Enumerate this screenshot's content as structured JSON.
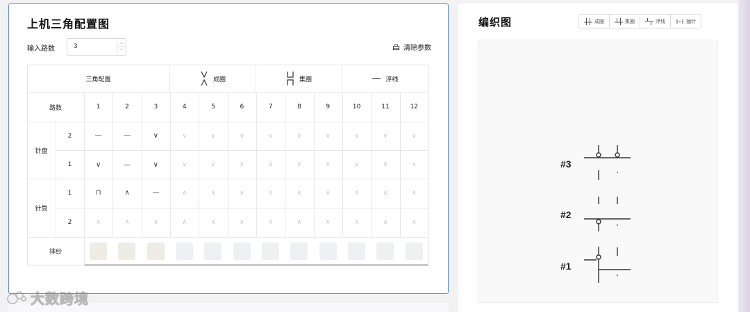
{
  "left_panel": {
    "title": "上机三角配置图",
    "paths_label": "输入路数",
    "paths_value": "3",
    "clear_label": "清除参数"
  },
  "table": {
    "group_headers": [
      {
        "symbol": "",
        "label": "三角配置"
      },
      {
        "symbol": "tuck-icon",
        "label": "成圈"
      },
      {
        "symbol": "knit-icon",
        "label": "集圈"
      },
      {
        "symbol": "float-icon",
        "label": "浮线"
      }
    ],
    "paths_header": "路数",
    "path_numbers": [
      "1",
      "2",
      "3",
      "4",
      "5",
      "6",
      "7",
      "8",
      "9",
      "10",
      "11",
      "12"
    ],
    "dial_label": "针盘",
    "cylinder_label": "针筒",
    "yarn_label": "排纱",
    "rows": [
      {
        "group": "dial",
        "num": "2",
        "symbols": [
          "—",
          "—",
          "∨",
          "∨",
          "∨",
          "∨",
          "∨",
          "∨",
          "∨",
          "∨",
          "∨",
          "∨"
        ]
      },
      {
        "group": "dial",
        "num": "1",
        "symbols": [
          "∨",
          "—",
          "∨",
          "∨",
          "∨",
          "∨",
          "∨",
          "∨",
          "∨",
          "∨",
          "∨",
          "∨"
        ]
      },
      {
        "group": "cylinder",
        "num": "1",
        "symbols": [
          "⊓",
          "∧",
          "—",
          "∧",
          "∧",
          "∧",
          "∧",
          "∧",
          "∧",
          "∧",
          "∧",
          "∧"
        ]
      },
      {
        "group": "cylinder",
        "num": "2",
        "symbols": [
          "∧",
          "∧",
          "∧",
          "∧",
          "∧",
          "∧",
          "∧",
          "∧",
          "∧",
          "∧",
          "∧",
          "∧"
        ]
      }
    ],
    "active_count": 3,
    "swatch_active_color": "#efebe5",
    "swatch_inactive_color": "#eef0f3"
  },
  "right_panel": {
    "title": "编织图",
    "legend": [
      {
        "icon": "tuck-stitch-icon",
        "label": "成圈"
      },
      {
        "icon": "knit-stitch-icon",
        "label": "集圈"
      },
      {
        "icon": "float-stitch-icon",
        "label": "浮线"
      },
      {
        "icon": "needle-icon",
        "label": "抽针"
      }
    ],
    "course_labels": [
      "#3",
      "#2",
      "#1"
    ]
  },
  "watermark": "大数跨境"
}
